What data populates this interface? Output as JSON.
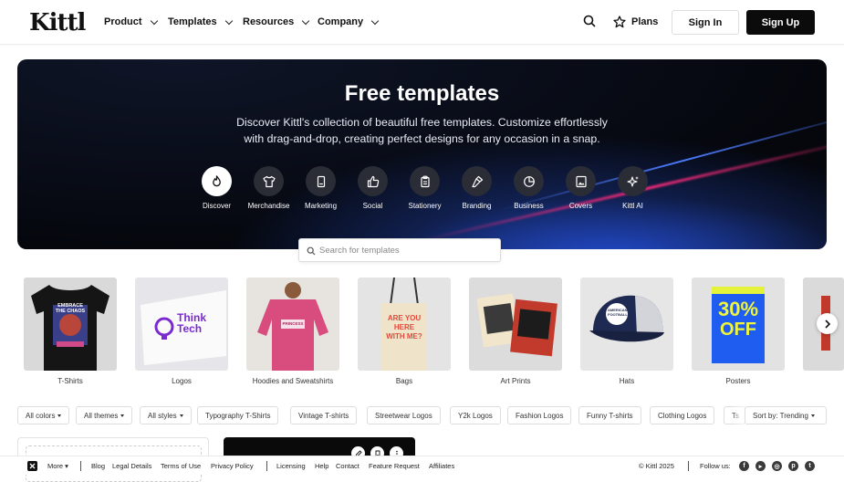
{
  "brand": {
    "logo": "Kittl"
  },
  "nav": {
    "menus": [
      "Product",
      "Templates",
      "Resources",
      "Company"
    ],
    "plans": "Plans",
    "sign_in": "Sign In",
    "sign_up": "Sign Up"
  },
  "hero": {
    "title": "Free templates",
    "description": "Discover Kittl's collection of beautiful free templates. Customize effortlessly with drag-and-drop, creating perfect designs for any occasion in a snap.",
    "categories": [
      "Discover",
      "Merchandise",
      "Marketing",
      "Social",
      "Stationery",
      "Branding",
      "Business",
      "Covers",
      "Kittl AI"
    ]
  },
  "search": {
    "placeholder": "Search for templates"
  },
  "carousel": {
    "items": [
      "T-Shirts",
      "Logos",
      "Hoodies and Sweatshirts",
      "Bags",
      "Art Prints",
      "Hats",
      "Posters"
    ]
  },
  "filters": {
    "selects": [
      "All colors",
      "All themes",
      "All styles"
    ],
    "chips": [
      "Typography T-Shirts",
      "Vintage T-shirts",
      "Streetwear Logos",
      "Y2k Logos",
      "Fashion Logos",
      "Funny T-shirts",
      "Clothing Logos",
      "Ts"
    ],
    "sort": "Sort by: Trending"
  },
  "card_texts": {
    "tshirt": "EMBRACE THE CHAOS",
    "logo": "Think Tech",
    "hoodie": "PRINCESS",
    "bag": "ARE YOU HERE WITH ME?",
    "poster_big": "30%",
    "poster_off": "OFF",
    "hat": "AMERICAN FOOTBALL"
  },
  "footer": {
    "more": "More",
    "links_left": [
      "Blog",
      "Legal Details",
      "Terms of Use",
      "Privacy Policy"
    ],
    "links_mid": [
      "Licensing",
      "Help",
      "Contact",
      "Feature Request",
      "Affiliates"
    ],
    "copyright": "© Kittl 2025",
    "follow": "Follow us:"
  },
  "colors": {
    "accent": "#0b0b0b",
    "hero_bg": "#05070d",
    "hero_glow": "#4d7bff",
    "streak": "#ff2a7a"
  }
}
